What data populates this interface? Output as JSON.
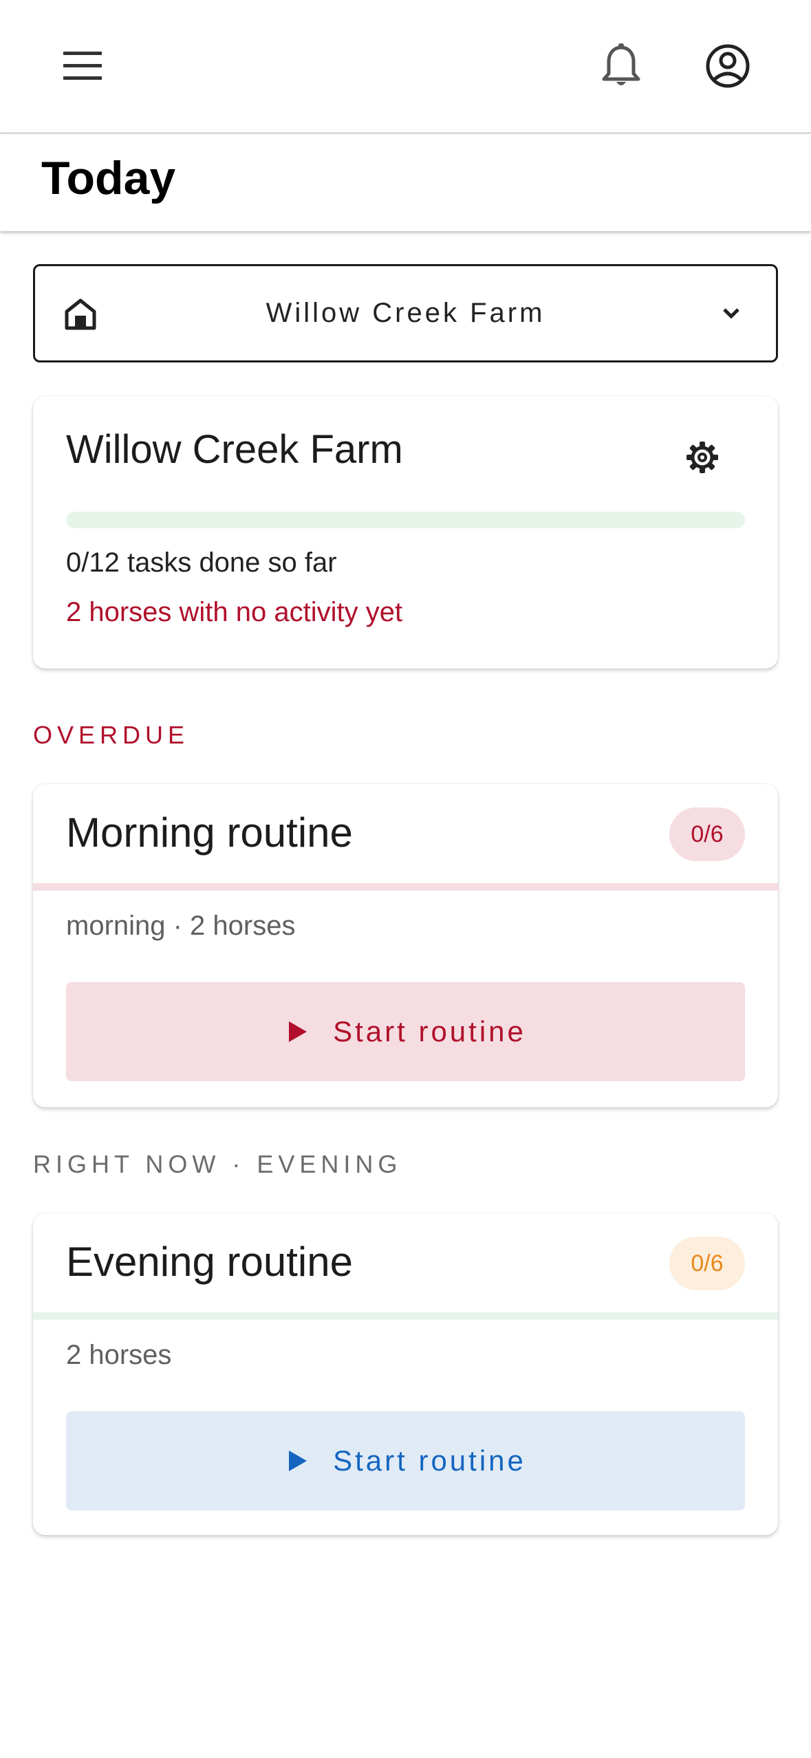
{
  "header": {
    "page_title": "Today"
  },
  "farm_selector": {
    "selected": "Willow Creek Farm"
  },
  "summary": {
    "farm_name": "Willow Creek Farm",
    "progress_fraction": 0,
    "tasks_text": "0/12 tasks done so far",
    "warning_text": "2 horses with no activity yet"
  },
  "sections": {
    "overdue_label": "OVERDUE",
    "now_label": "RIGHT NOW · EVENING"
  },
  "routines": [
    {
      "title": "Morning routine",
      "count": "0/6",
      "meta": "morning · 2 horses",
      "button_label": "Start routine"
    },
    {
      "title": "Evening routine",
      "count": "0/6",
      "meta": "2 horses",
      "button_label": "Start routine"
    }
  ],
  "colors": {
    "overdue_red": "#b0102b",
    "evening_orange": "#e8891b",
    "action_blue": "#1565c0"
  },
  "icons": {
    "menu": "menu-icon",
    "notifications": "bell-icon",
    "account": "account-circle-icon",
    "farm": "home-icon",
    "dropdown": "chevron-down-icon",
    "settings": "gear-icon",
    "start": "play-icon"
  }
}
